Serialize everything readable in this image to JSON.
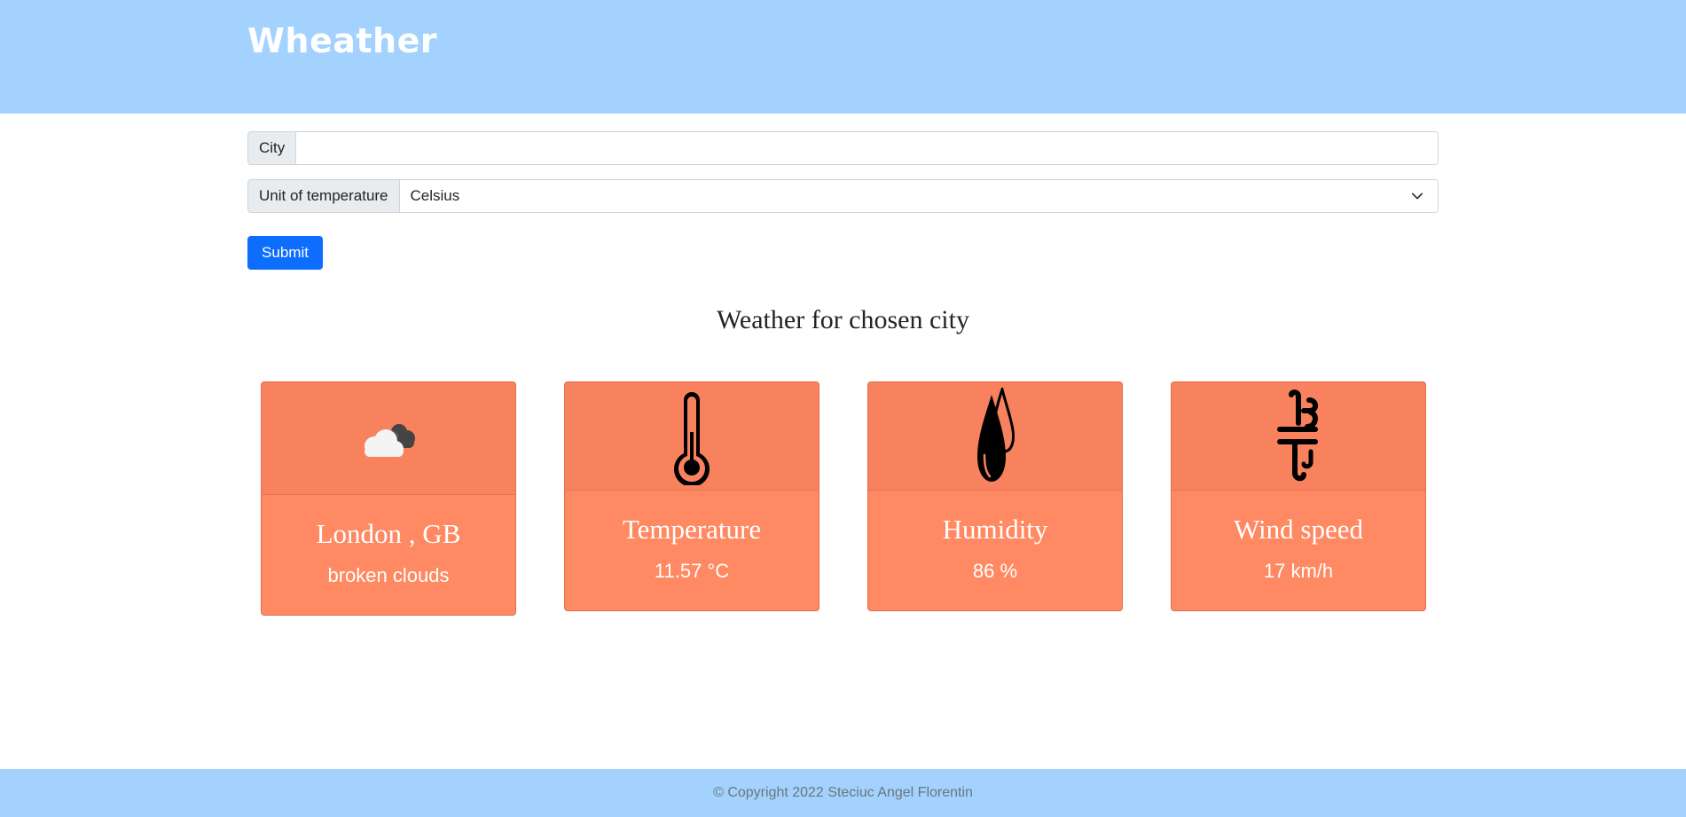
{
  "header": {
    "brand": "Wheather"
  },
  "form": {
    "city": {
      "label": "City",
      "value": ""
    },
    "unit": {
      "label": "Unit of temperature",
      "selected": "Celsius"
    },
    "submit_label": "Submit"
  },
  "section_title": "Weather for chosen city",
  "cards": [
    {
      "icon": "cloud-icon",
      "title": "London , GB",
      "text": "broken clouds"
    },
    {
      "icon": "thermometer-icon",
      "title": "Temperature",
      "text": "11.57 °C"
    },
    {
      "icon": "humidity-icon",
      "title": "Humidity",
      "text": "86 %"
    },
    {
      "icon": "wind-icon",
      "title": "Wind speed",
      "text": "17 km/h"
    }
  ],
  "footer": {
    "text": "© Copyright 2022 Steciuc Angel Florentin"
  },
  "colors": {
    "header": "#a2d2fd",
    "card": "#ff8962",
    "button": "#0d6efd"
  }
}
